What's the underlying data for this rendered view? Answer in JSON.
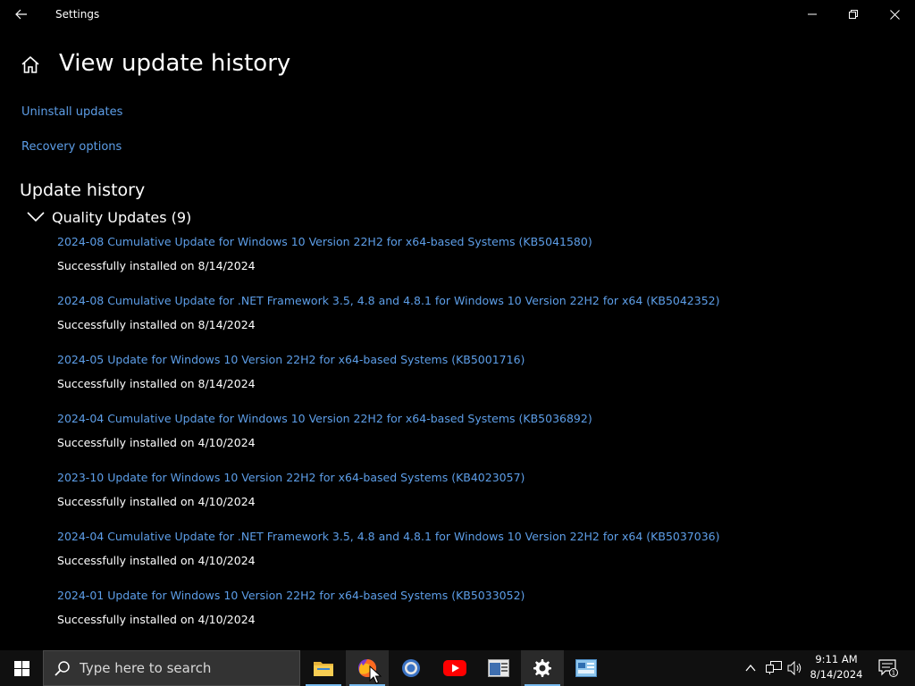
{
  "window": {
    "title": "Settings"
  },
  "page": {
    "title": "View update history",
    "links": {
      "uninstall": "Uninstall updates",
      "recovery": "Recovery options"
    }
  },
  "history": {
    "title": "Update history",
    "group_label": "Quality Updates (9)",
    "updates": [
      {
        "name": "2024-08 Cumulative Update for Windows 10 Version 22H2 for x64-based Systems (KB5041580)",
        "status": "Successfully installed on 8/14/2024"
      },
      {
        "name": "2024-08 Cumulative Update for .NET Framework 3.5, 4.8 and 4.8.1 for Windows 10 Version 22H2 for x64 (KB5042352)",
        "status": "Successfully installed on 8/14/2024"
      },
      {
        "name": "2024-05 Update for Windows 10 Version 22H2 for x64-based Systems (KB5001716)",
        "status": "Successfully installed on 8/14/2024"
      },
      {
        "name": "2024-04 Cumulative Update for Windows 10 Version 22H2 for x64-based Systems (KB5036892)",
        "status": "Successfully installed on 4/10/2024"
      },
      {
        "name": "2023-10 Update for Windows 10 Version 22H2 for x64-based Systems (KB4023057)",
        "status": "Successfully installed on 4/10/2024"
      },
      {
        "name": "2024-04 Cumulative Update for .NET Framework 3.5, 4.8 and 4.8.1 for Windows 10 Version 22H2 for x64 (KB5037036)",
        "status": "Successfully installed on 4/10/2024"
      },
      {
        "name": "2024-01 Update for Windows 10 Version 22H2 for x64-based Systems (KB5033052)",
        "status": "Successfully installed on 4/10/2024"
      }
    ]
  },
  "taskbar": {
    "search_placeholder": "Type here to search",
    "clock_time": "9:11 AM",
    "clock_date": "8/14/2024",
    "notification_count": "1",
    "apps": [
      "file-explorer",
      "firefox",
      "chrome",
      "youtube",
      "taskbar-app",
      "settings",
      "control-panel"
    ]
  },
  "colors": {
    "background": "#000000",
    "link": "#5d9ee8",
    "taskbar": "#101010",
    "accent": "#76b9ed"
  }
}
